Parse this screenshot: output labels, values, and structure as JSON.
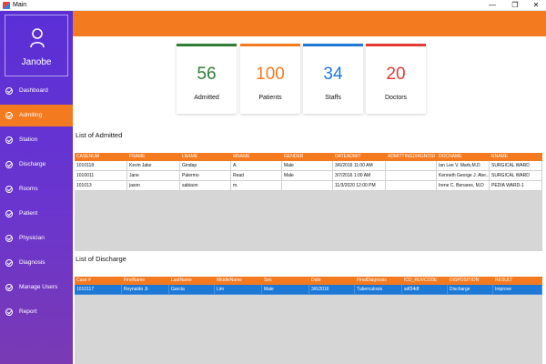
{
  "window": {
    "title": "Main",
    "minimize": "—",
    "maximize": "❐",
    "close": "✕"
  },
  "sidebar": {
    "user_name": "Janobe",
    "items": [
      {
        "label": "Dashboard",
        "active": false
      },
      {
        "label": "Admiting",
        "active": true
      },
      {
        "label": "Station",
        "active": false
      },
      {
        "label": "Discharge",
        "active": false
      },
      {
        "label": "Rooms",
        "active": false
      },
      {
        "label": "Patient",
        "active": false
      },
      {
        "label": "Physician",
        "active": false
      },
      {
        "label": "Diagnosis",
        "active": false
      },
      {
        "label": "Manage Users",
        "active": false
      },
      {
        "label": "Report",
        "active": false
      }
    ]
  },
  "stats": [
    {
      "value": "56",
      "label": "Admitted",
      "color": "#2e7d32"
    },
    {
      "value": "100",
      "label": "Patients",
      "color": "#f47a20"
    },
    {
      "value": "34",
      "label": "Staffs",
      "color": "#1e78d6"
    },
    {
      "value": "20",
      "label": "Doctors",
      "color": "#e53935"
    }
  ],
  "admitted": {
    "title": "List of Admitted",
    "columns": [
      "CASENUM",
      "FNAME",
      "LNAME",
      "MNAME",
      "GENDER",
      "DATEADMIT",
      "ADMITTINGDIAGNOSI",
      "DOCNAME",
      "RNAME"
    ],
    "rows": [
      [
        "1010118",
        "Kevin Jake",
        "Gindap",
        "A.",
        "Male",
        "3/6/2016 11:00 AM",
        "",
        "Ian Lee V. Marb,M.D",
        "SURGICAL WARD"
      ],
      [
        "1010011",
        "Jane",
        "Palermo",
        "Read",
        "Male",
        "3/7/2016 1:00 AM",
        "",
        "Kenneth George J. Aler...",
        "SURGICAL WARD"
      ],
      [
        "101013",
        "jason",
        "sabiaon",
        "m.",
        "",
        "11/3/2020 12:00 PM",
        "",
        "Irene C. Benares, M.D",
        "PEDIA WARD-1"
      ]
    ]
  },
  "discharged": {
    "title": "List of Discharge",
    "columns": [
      "Case #",
      "FirstName",
      "LastName",
      "MiddleName",
      "Sex",
      "Date",
      "FinalDiagnosis",
      "ICD_RUVCODE",
      "DISPOSITION",
      "RESULT"
    ],
    "rows": [
      [
        "1010117",
        "Reynaldo Jr.",
        "Garcia",
        "Lim",
        "Male",
        "3/6/2016",
        "Tuberculosis",
        "sdf34df",
        "Discharge",
        "Improve"
      ]
    ]
  }
}
